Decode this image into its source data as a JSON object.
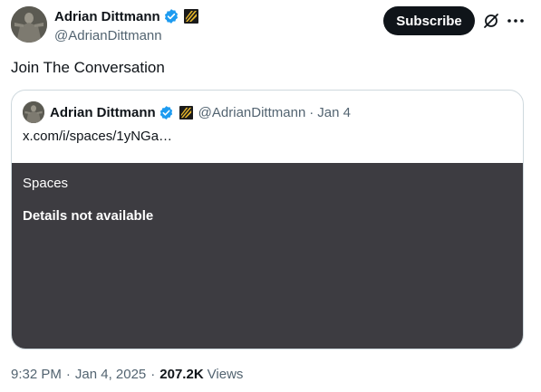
{
  "author": {
    "display_name": "Adrian Dittmann",
    "handle": "@AdrianDittmann",
    "verified_icon": "verified-badge-icon",
    "affiliation_icon": "affiliation-badge-icon"
  },
  "actions": {
    "subscribe_label": "Subscribe",
    "grok_icon": "grok-icon",
    "more_icon": "more-icon"
  },
  "tweet": {
    "text": "Join The Conversation"
  },
  "quote": {
    "display_name": "Adrian Dittmann",
    "handle": "@AdrianDittmann",
    "separator": "·",
    "date": "Jan 4",
    "link": "x.com/i/spaces/1yNGa…",
    "card": {
      "label": "Spaces",
      "details": "Details not available"
    }
  },
  "meta": {
    "time": "9:32 PM",
    "separator": "·",
    "date": "Jan 4, 2025",
    "views_count": "207.2K",
    "views_label": "Views"
  },
  "colors": {
    "accent": "#1d9bf0",
    "text_primary": "#0f1419",
    "text_secondary": "#536471",
    "card_background": "#3d3c41",
    "button_background": "#0f1419"
  }
}
